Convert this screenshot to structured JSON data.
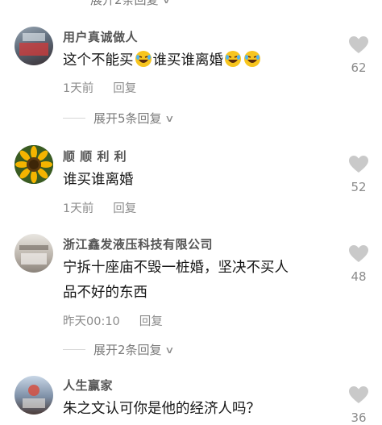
{
  "comments": [
    {
      "username": "用户真诚做人",
      "text_parts": [
        "这个不能买",
        "谁买谁离婚"
      ],
      "emoji": "rolling-on-floor-laughing-emoji",
      "time": "1天前",
      "reply_label": "回复",
      "likes": "62",
      "expand_label": "展开5条回复"
    },
    {
      "username": "顺 顺 利 利",
      "text": "谁买谁离婚",
      "time": "1天前",
      "reply_label": "回复",
      "likes": "52"
    },
    {
      "username": "浙江鑫发液压科技有限公司",
      "text_line1": "宁拆十座庙不毁一桩婚，坚决不买人",
      "text_line2": "品不好的东西",
      "time": "昨天00:10",
      "reply_label": "回复",
      "likes": "48",
      "expand_label": "展开2条回复"
    },
    {
      "username": "人生赢家",
      "text": "朱之文认可你是他的经济人吗？",
      "likes": "36"
    }
  ],
  "top_expand_label": "展开2条回复",
  "icons": {
    "like": "heart-icon",
    "expand": "chevron-down-icon"
  },
  "colors": {
    "like_icon": "#c9c9c9",
    "meta_text": "#8c8c8c",
    "username": "#555555"
  }
}
